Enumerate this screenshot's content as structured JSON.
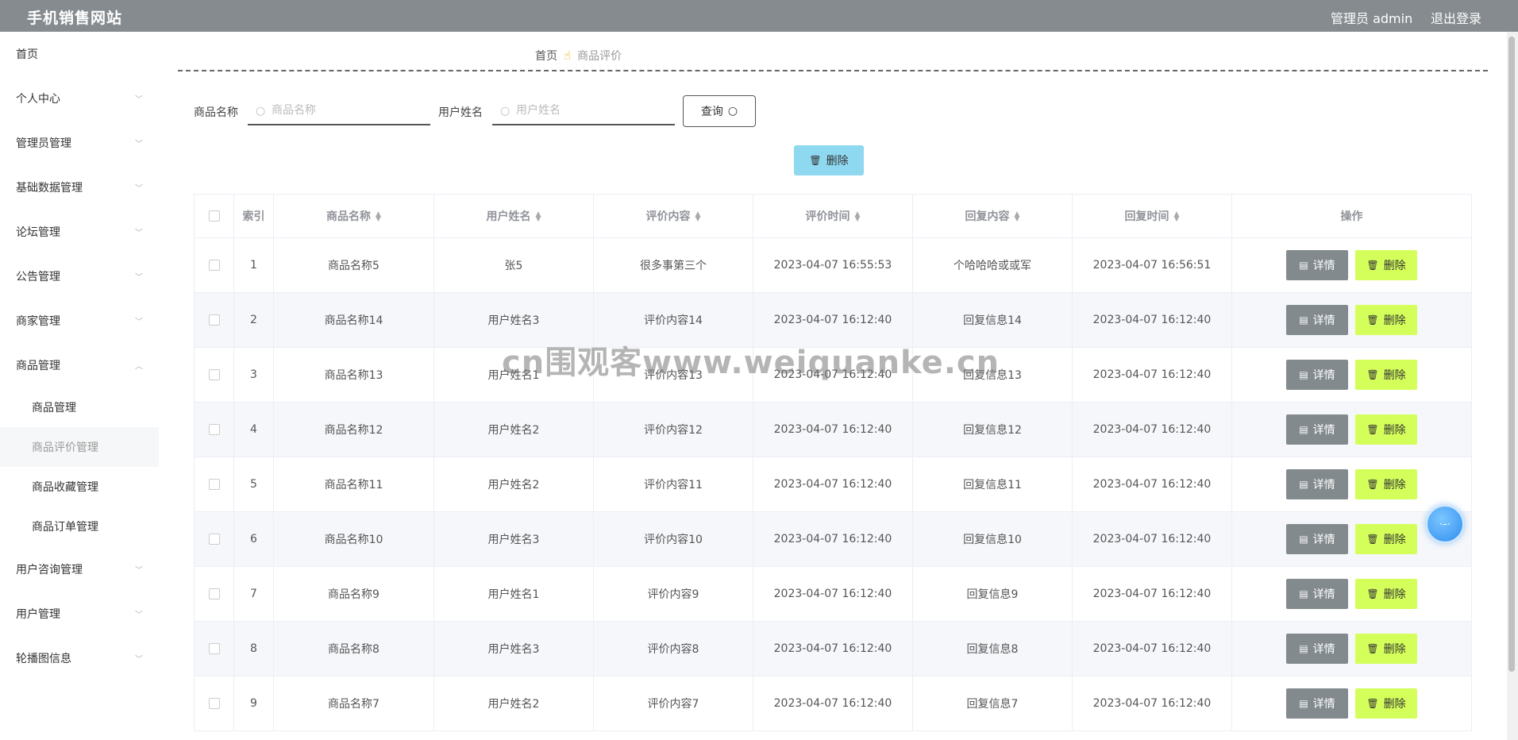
{
  "header": {
    "site_title": "手机销售网站",
    "user_text": "管理员 admin",
    "logout_label": "退出登录"
  },
  "sidebar": {
    "items": [
      {
        "label": "首页",
        "has_arrow": false
      },
      {
        "label": "个人中心",
        "has_arrow": true
      },
      {
        "label": "管理员管理",
        "has_arrow": true
      },
      {
        "label": "基础数据管理",
        "has_arrow": true
      },
      {
        "label": "论坛管理",
        "has_arrow": true
      },
      {
        "label": "公告管理",
        "has_arrow": true
      },
      {
        "label": "商家管理",
        "has_arrow": true
      },
      {
        "label": "商品管理",
        "has_arrow": true,
        "expanded": true
      }
    ],
    "sub_items": [
      {
        "label": "商品管理"
      },
      {
        "label": "商品评价管理",
        "active": true
      },
      {
        "label": "商品收藏管理"
      },
      {
        "label": "商品订单管理"
      }
    ],
    "items_after": [
      {
        "label": "用户咨询管理",
        "has_arrow": true
      },
      {
        "label": "用户管理",
        "has_arrow": true
      },
      {
        "label": "轮播图信息",
        "has_arrow": true
      }
    ]
  },
  "breadcrumb": {
    "home": "首页",
    "current": "商品评价"
  },
  "search": {
    "product_label": "商品名称",
    "product_placeholder": "商品名称",
    "user_label": "用户姓名",
    "user_placeholder": "用户姓名",
    "query_label": "查询"
  },
  "toolbar": {
    "batch_delete_label": "删除"
  },
  "table": {
    "headers": [
      "索引",
      "商品名称",
      "用户姓名",
      "评价内容",
      "评价时间",
      "回复内容",
      "回复时间",
      "操作"
    ],
    "detail_label": "详情",
    "delete_label": "删除",
    "rows": [
      {
        "index": "1",
        "product": "商品名称5",
        "user": "张5",
        "content": "很多事第三个",
        "time": "2023-04-07 16:55:53",
        "reply": "个哈哈哈或或军",
        "reply_time": "2023-04-07 16:56:51"
      },
      {
        "index": "2",
        "product": "商品名称14",
        "user": "用户姓名3",
        "content": "评价内容14",
        "time": "2023-04-07 16:12:40",
        "reply": "回复信息14",
        "reply_time": "2023-04-07 16:12:40"
      },
      {
        "index": "3",
        "product": "商品名称13",
        "user": "用户姓名1",
        "content": "评价内容13",
        "time": "2023-04-07 16:12:40",
        "reply": "回复信息13",
        "reply_time": "2023-04-07 16:12:40"
      },
      {
        "index": "4",
        "product": "商品名称12",
        "user": "用户姓名2",
        "content": "评价内容12",
        "time": "2023-04-07 16:12:40",
        "reply": "回复信息12",
        "reply_time": "2023-04-07 16:12:40"
      },
      {
        "index": "5",
        "product": "商品名称11",
        "user": "用户姓名2",
        "content": "评价内容11",
        "time": "2023-04-07 16:12:40",
        "reply": "回复信息11",
        "reply_time": "2023-04-07 16:12:40"
      },
      {
        "index": "6",
        "product": "商品名称10",
        "user": "用户姓名3",
        "content": "评价内容10",
        "time": "2023-04-07 16:12:40",
        "reply": "回复信息10",
        "reply_time": "2023-04-07 16:12:40"
      },
      {
        "index": "7",
        "product": "商品名称9",
        "user": "用户姓名1",
        "content": "评价内容9",
        "time": "2023-04-07 16:12:40",
        "reply": "回复信息9",
        "reply_time": "2023-04-07 16:12:40"
      },
      {
        "index": "8",
        "product": "商品名称8",
        "user": "用户姓名3",
        "content": "评价内容8",
        "time": "2023-04-07 16:12:40",
        "reply": "回复信息8",
        "reply_time": "2023-04-07 16:12:40"
      },
      {
        "index": "9",
        "product": "商品名称7",
        "user": "用户姓名2",
        "content": "评价内容7",
        "time": "2023-04-07 16:12:40",
        "reply": "回复信息7",
        "reply_time": "2023-04-07 16:12:40"
      }
    ]
  },
  "watermark": "cn围观客www.weiquanke.cn",
  "colors": {
    "header_bg": "#858b8f",
    "detail_btn": "#828a8e",
    "delete_btn": "#d4ff5a",
    "batch_delete_btn": "#8ed8f0",
    "float_ball": "#2f8ef0"
  },
  "icons": {
    "sort": "sort-icon",
    "detail": "document-icon",
    "delete": "trash-icon",
    "search": "search-icon",
    "hand": "hand-pointer-icon"
  }
}
